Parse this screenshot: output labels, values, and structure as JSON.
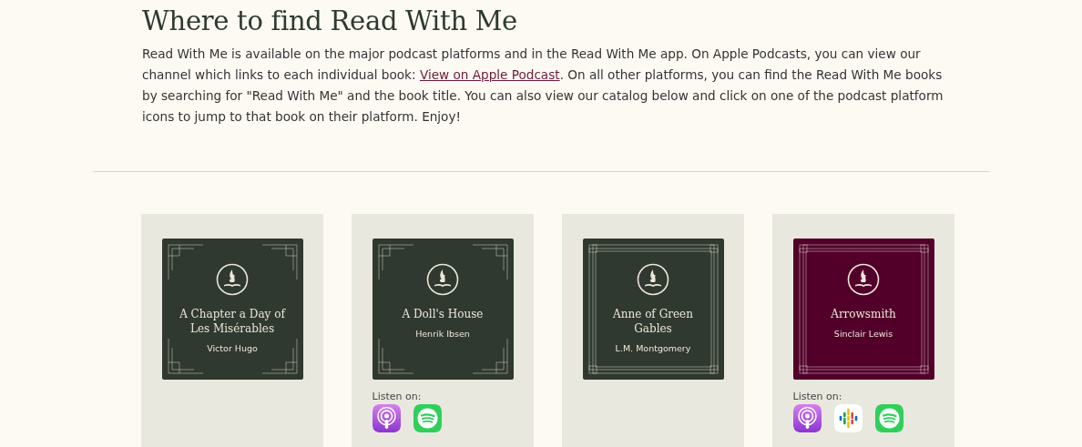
{
  "heading": "Where to find Read With Me",
  "intro": {
    "before": "Read With Me is available on the major podcast platforms and in the Read With Me app. On Apple Podcasts, you can view our channel which links to each individual book: ",
    "link": "View on Apple Podcast",
    "after": ". On all other platforms, you can find the Read With Me books by searching for \"Read With Me\" and the book title. You can also view our catalog below and click on one of the podcast platform icons to jump to that book on their platform. Enjoy!"
  },
  "books": [
    {
      "title": "A Chapter a Day of Les Misérables",
      "author": "Victor Hugo",
      "color": "#2f392f",
      "kind": "corners"
    },
    {
      "title": "A Doll's House",
      "author": "Henrik Ibsen",
      "color": "#2f392f",
      "kind": "corners",
      "listen_label": "Listen on:",
      "platforms": [
        {
          "kind": "apple"
        },
        {
          "kind": "spotify"
        }
      ]
    },
    {
      "title": "Anne of Green Gables",
      "author": "L.M. Montgomery",
      "color": "#2f392f",
      "kind": "frame"
    },
    {
      "title": "Arrowsmith",
      "author": "Sinclair Lewis",
      "color": "#52002a",
      "kind": "frame",
      "listen_label": "Listen on:",
      "platforms": [
        {
          "kind": "apple"
        },
        {
          "kind": "google"
        },
        {
          "kind": "spotify"
        }
      ]
    }
  ]
}
